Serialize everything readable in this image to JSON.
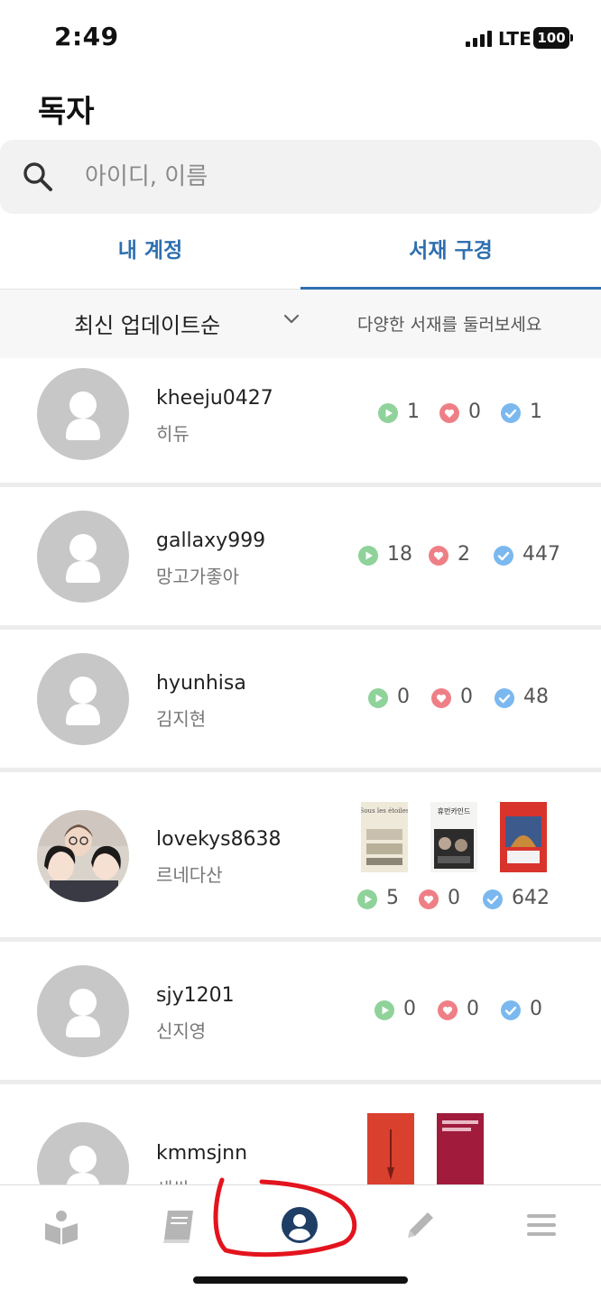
{
  "status_bar": {
    "time": "2:49",
    "network": "LTE",
    "battery": "100"
  },
  "header": {
    "title": "독자"
  },
  "search": {
    "placeholder": "아이디, 이름"
  },
  "tabs": [
    {
      "label": "내 계정",
      "active": false
    },
    {
      "label": "서재 구경",
      "active": true
    }
  ],
  "sort": {
    "selected": "최신 업데이트순",
    "hint": "다양한 서재를 둘러보세요"
  },
  "colors": {
    "accent": "#2f6fb0",
    "reading": "#8fd29a",
    "liked": "#ef7f86",
    "done": "#7bb8ef",
    "avatar": "#c7c7c7",
    "annotation": "#e3141e"
  },
  "users": [
    {
      "username": "kheeju0427",
      "name": "히듀",
      "reading": "1",
      "liked": "0",
      "done": "1",
      "avatar": "default-avatar-icon"
    },
    {
      "username": "gallaxy999",
      "name": "망고가좋아",
      "reading": "18",
      "liked": "2",
      "done": "447",
      "avatar": "default-avatar-icon"
    },
    {
      "username": "hyunhisa",
      "name": "김지현",
      "reading": "0",
      "liked": "0",
      "done": "48",
      "avatar": "default-avatar-icon"
    },
    {
      "username": "lovekys8638",
      "name": "르네다산",
      "reading": "5",
      "liked": "0",
      "done": "642",
      "avatar": "photo-avatar",
      "books": [
        "Sous les étoiles",
        "휴먼카인드",
        ""
      ]
    },
    {
      "username": "sjy1201",
      "name": "신지영",
      "reading": "0",
      "liked": "0",
      "done": "0",
      "avatar": "default-avatar-icon"
    },
    {
      "username": "kmmsjnn",
      "name": "새싹",
      "avatar": "default-avatar-icon",
      "books": [
        "",
        ""
      ]
    }
  ],
  "bottom_nav": [
    {
      "icon": "book-reader-icon",
      "active": false
    },
    {
      "icon": "bookshelf-icon",
      "active": false
    },
    {
      "icon": "user-circle-icon",
      "active": true
    },
    {
      "icon": "pencil-icon",
      "active": false
    },
    {
      "icon": "menu-icon",
      "active": false
    }
  ]
}
